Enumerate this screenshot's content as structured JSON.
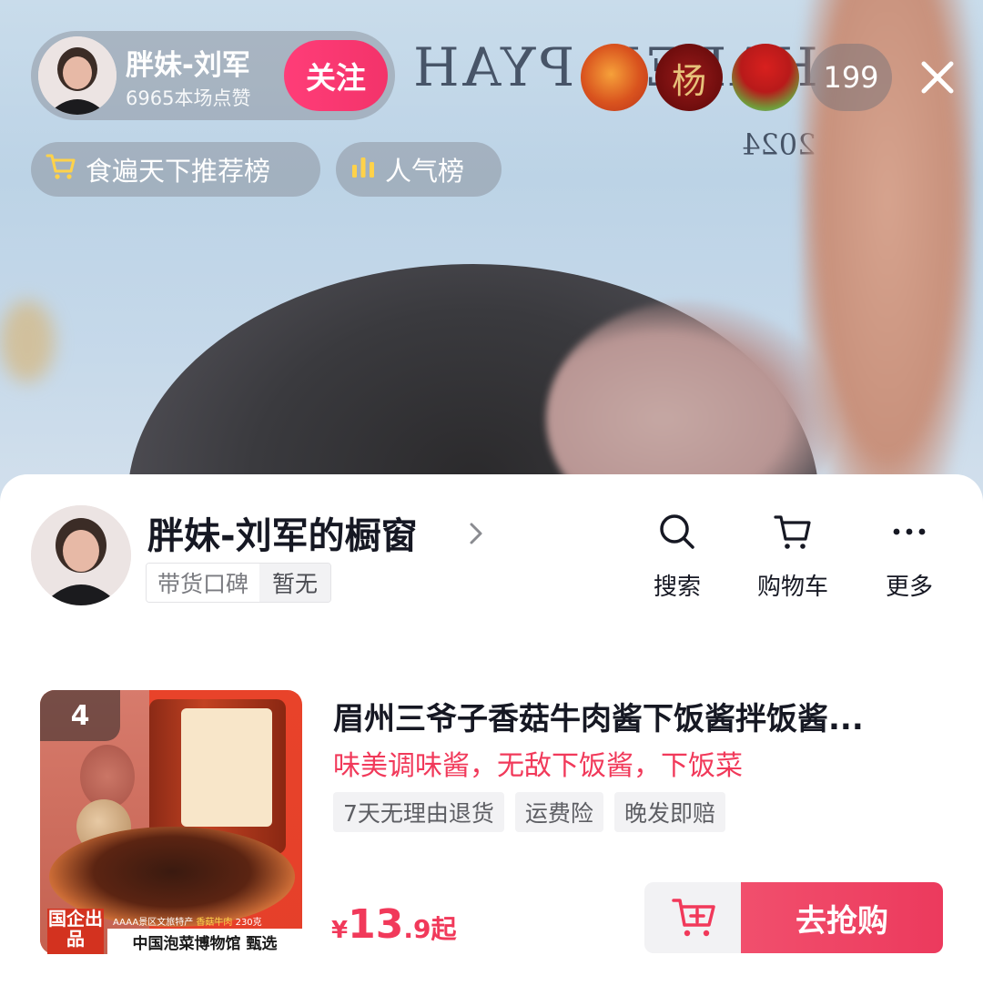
{
  "host": {
    "name": "胖妹-刘军",
    "likes": "6965本场点赞",
    "follow_label": "关注"
  },
  "viewers": {
    "avatars": [
      "viewer-avatar-food",
      "viewer-avatar-yang-char",
      "viewer-avatar-red-tree"
    ],
    "avatar_char": "杨",
    "count": "199"
  },
  "rank_pills": [
    {
      "icon": "cart-icon",
      "label": "食遍天下推荐榜"
    },
    {
      "icon": "bar-chart-icon",
      "label": "人气榜"
    }
  ],
  "shop": {
    "title": "胖妹-刘军的橱窗",
    "reputation_label": "带货口碑",
    "reputation_value": "暂无",
    "tools": [
      {
        "icon": "search-icon",
        "label": "搜索"
      },
      {
        "icon": "cart-icon",
        "label": "购物车"
      },
      {
        "icon": "more-icon",
        "label": "更多"
      }
    ]
  },
  "product": {
    "rank": "4",
    "image_badge": "国企出品",
    "image_strip_prefix": "AAAA景区文旅特产",
    "image_strip_highlight": "香菇牛肉",
    "image_strip_weight": "230克",
    "image_bottom_text": "中国泡菜博物馆 甄选",
    "title": "眉州三爷子香菇牛肉酱下饭酱拌饭酱...",
    "subtitle": "味美调味酱，无敌下饭酱，下饭菜",
    "tags": [
      "7天无理由退货",
      "运费险",
      "晚发即赔"
    ],
    "price_symbol": "¥",
    "price_int": "13",
    "price_dec": ".9起",
    "buy_label": "去抢购"
  },
  "colors": {
    "accent": "#f1395a",
    "follow": "#f3336a",
    "yellow_icon": "#ffd24a"
  }
}
